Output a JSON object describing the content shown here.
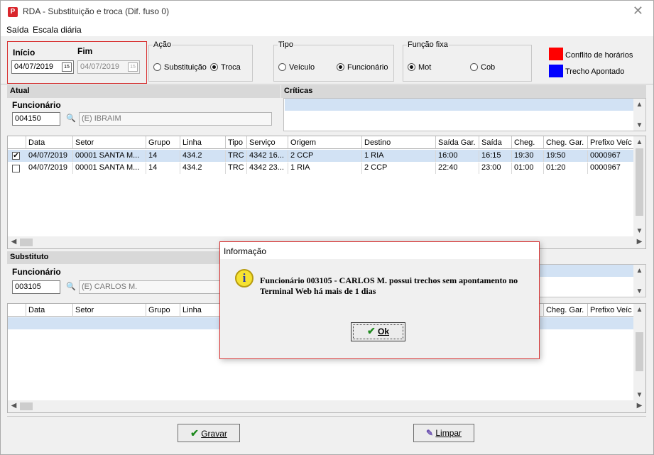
{
  "window": {
    "title": "RDA - Substituição e troca (Dif. fuso 0)",
    "app_icon": "P"
  },
  "menu": [
    "Saída",
    "Escala diária"
  ],
  "dates": {
    "inicio_label": "Início",
    "fim_label": "Fim",
    "inicio_value": "04/07/2019",
    "fim_value": "04/07/2019",
    "cal_glyph": "15"
  },
  "acao": {
    "label": "Ação",
    "options": [
      "Substituição",
      "Troca"
    ],
    "selected": "Troca"
  },
  "tipo": {
    "label": "Tipo",
    "options": [
      "Veículo",
      "Funcionário"
    ],
    "selected": "Funcionário"
  },
  "funcao_fixa": {
    "label": "Função fixa",
    "options": [
      "Mot",
      "Cob"
    ],
    "selected": "Mot"
  },
  "legend": [
    {
      "label": "Conflito de horários",
      "color": "#ff0000"
    },
    {
      "label": "Trecho Apontado",
      "color": "#0000ff"
    }
  ],
  "atual": {
    "header": "Atual",
    "criticas_header": "Críticas",
    "funcionario_label": "Funcionário",
    "code": "004150",
    "name": "(E) IBRAIM",
    "columns": [
      "Data",
      "Setor",
      "Grupo",
      "Linha",
      "Tipo",
      "Serviço",
      "Origem",
      "Destino",
      "Saída Gar.",
      "Saída",
      "Cheg.",
      "Cheg. Gar.",
      "Prefixo Veíc"
    ],
    "rows": [
      {
        "checked": true,
        "cells": [
          "04/07/2019",
          "00001 SANTA M...",
          "14",
          "434.2",
          "TRC",
          "4342 16...",
          "2 CCP",
          "1 RIA",
          "16:00",
          "16:15",
          "19:30",
          "19:50",
          "0000967"
        ]
      },
      {
        "checked": false,
        "cells": [
          "04/07/2019",
          "00001 SANTA M...",
          "14",
          "434.2",
          "TRC",
          "4342 23...",
          "1 RIA",
          "2 CCP",
          "22:40",
          "23:00",
          "01:00",
          "01:20",
          "0000967"
        ]
      }
    ]
  },
  "substituto": {
    "header": "Substituto",
    "funcionario_label": "Funcionário",
    "code": "003105",
    "name": "(E) CARLOS M.",
    "columns_left": [
      "Data",
      "Setor",
      "Grupo",
      "Linha"
    ],
    "columns_right": [
      "Cheg. Gar.",
      "Prefixo Veíc"
    ]
  },
  "buttons": {
    "gravar": "Gravar",
    "limpar": "Limpar"
  },
  "dialog": {
    "title": "Informação",
    "message": "Funcionário 003105 - CARLOS M. possui trechos sem apontamento no Terminal Web há mais de 1 dias",
    "ok": "Ok"
  }
}
